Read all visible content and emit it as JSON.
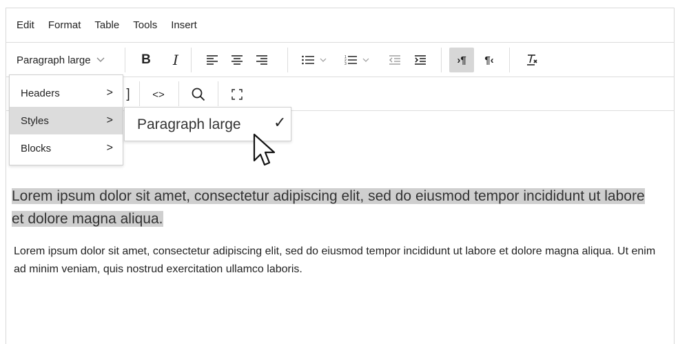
{
  "menubar": {
    "items": [
      "Edit",
      "Format",
      "Table",
      "Tools",
      "Insert"
    ]
  },
  "toolbar": {
    "style_select_value": "Paragraph large",
    "buttons": [
      {
        "name": "bold",
        "glyph": "B"
      },
      {
        "name": "italic",
        "glyph": "I"
      },
      {
        "name": "align-left",
        "icon": "align-left-icon"
      },
      {
        "name": "align-center",
        "icon": "align-center-icon"
      },
      {
        "name": "align-right",
        "icon": "align-right-icon"
      },
      {
        "name": "bullet-list",
        "icon": "bullet-list-icon"
      },
      {
        "name": "numbered-list",
        "icon": "numbered-list-icon"
      },
      {
        "name": "outdent",
        "icon": "outdent-icon"
      },
      {
        "name": "indent",
        "icon": "indent-icon"
      },
      {
        "name": "ltr",
        "icon": "ltr-paragraph-icon",
        "active": true
      },
      {
        "name": "rtl",
        "icon": "rtl-paragraph-icon"
      },
      {
        "name": "clear-formatting",
        "icon": "clear-formatting-icon"
      }
    ],
    "row2": [
      {
        "name": "code",
        "glyph": "<>"
      },
      {
        "name": "search",
        "icon": "search-icon"
      },
      {
        "name": "fullscreen",
        "icon": "fullscreen-icon"
      }
    ]
  },
  "format_menu": {
    "items": [
      {
        "label": "Headers"
      },
      {
        "label": "Styles",
        "selected": true
      },
      {
        "label": "Blocks"
      }
    ],
    "arrow": ">"
  },
  "styles_submenu": {
    "item_label": "Paragraph large",
    "check": "✓"
  },
  "content": {
    "para_large": "Lorem ipsum dolor sit amet, consectetur adipiscing elit, sed do eiusmod tempor incididunt ut labore et dolore magna aliqua.",
    "para_normal": "Lorem ipsum dolor sit amet, consectetur adipiscing elit, sed do eiusmod tempor incididunt ut labore et dolore magna aliqua. Ut enim ad minim veniam, quis nostrud exercitation ullamco laboris."
  },
  "colors": {
    "highlight": "#cfcfcf",
    "active_button": "#d7d7d7",
    "border": "#d8d8d8"
  }
}
